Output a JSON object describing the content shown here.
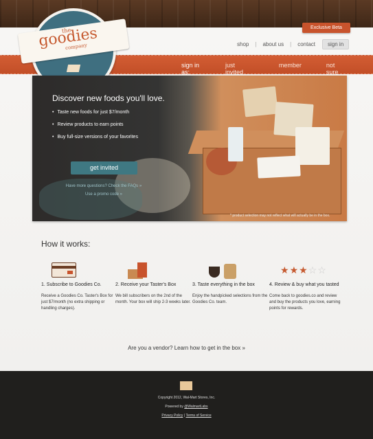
{
  "header": {
    "beta_label": "Exclusive Beta",
    "nav": [
      {
        "label": "shop"
      },
      {
        "label": "about us"
      },
      {
        "label": "contact"
      },
      {
        "label": "sign in"
      }
    ]
  },
  "logo": {
    "the": "the",
    "name": "goodies",
    "company": "company"
  },
  "band": {
    "label": "sign in as:",
    "options": [
      "just invited",
      "member",
      "not sure"
    ]
  },
  "hero": {
    "title": "Discover new foods you'll love.",
    "bullets": [
      "Taste new foods for just $7/month",
      "Review products to earn points",
      "Buy full-size versions of your favorites"
    ],
    "cta": "get invited",
    "faq_link": "Have more questions? Check the FAQs »",
    "promo_link": "Use a promo code »",
    "disclaimer": "* product selection may not reflect what will actually be in the box."
  },
  "how": {
    "title": "How it works:",
    "steps": [
      {
        "title": "1. Subscribe to Goodies Co.",
        "desc": "Receive a Goodies Co. Taster's Box for just $7/month (no extra shipping or handling charges)."
      },
      {
        "title": "2. Receive your Taster's Box",
        "desc": "We bill subscribers on the 2nd of the month. Your box will ship 2-3 weeks later."
      },
      {
        "title": "3. Taste everything in the box",
        "desc": "Enjoy the handpicked selections from the Goodies Co. team."
      },
      {
        "title": "4. Review & buy what you tasted",
        "desc": "Come back to goodies.co and review and buy the products you love, earning points for rewards."
      }
    ],
    "stars_filled": 3,
    "stars_total": 5
  },
  "vendor": {
    "question": "Are you a vendor?",
    "link": "Learn how to get in the box »"
  },
  "footer": {
    "copyright": "Copyright 2012, Wal-Mart Stores, Inc.",
    "powered_prefix": "Powered by",
    "powered_by": "@WalmartLabs",
    "privacy": "Privacy Policy",
    "terms": "Terms of Service"
  },
  "colors": {
    "accent": "#c8532c",
    "teal": "#3f7882",
    "footer": "#201f1d"
  }
}
